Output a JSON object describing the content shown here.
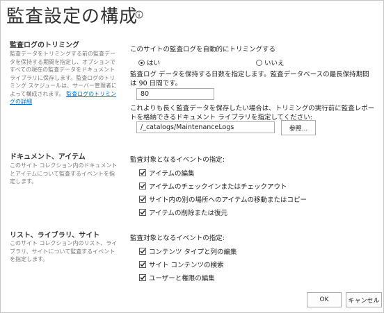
{
  "page": {
    "title": "監査設定の構成",
    "info_icon": "info-icon"
  },
  "trimming": {
    "title": "監査ログのトリミング",
    "description": "監査データをトリミングする前の監査データを保持する期間を指定し、オプションですべての現在の監査データをドキュメント ライブラリに保存します。監査ログのトリミング スケジュールは、サーバー管理者によって構成されます。",
    "link": "監査ログのトリミングの詳細",
    "auto_trim_label": "このサイトの監査ログを自動的にトリミングする",
    "radio_yes": "はい",
    "radio_no": "いいえ",
    "selected": "はい",
    "days_label": "監査ログ データを保持する日数を指定します。監査データベースの最長保持期間は 90 日間です。",
    "days_value": "80",
    "library_label": "これよりも長く監査データを保存したい場合は、トリミングの実行前に監査レポートを格納できるドキュメント ライブラリを指定してください:",
    "library_value": "/_catalogs/MaintenanceLogs",
    "browse_button": "参照..."
  },
  "documents": {
    "title": "ドキュメント、アイテム",
    "description": "このサイト コレクション内のドキュメントとアイテムについて監査するイベントを指定します。",
    "events_label": "監査対象となるイベントの指定:",
    "events": [
      {
        "label": "アイテムの編集",
        "checked": true
      },
      {
        "label": "アイテムのチェックインまたはチェックアウト",
        "checked": true
      },
      {
        "label": "サイト内の別の場所へのアイテムの移動またはコピー",
        "checked": true
      },
      {
        "label": "アイテムの削除または復元",
        "checked": true
      }
    ]
  },
  "lists": {
    "title": "リスト、ライブラリ、サイト",
    "description": "このサイト コレクション内のリスト、ライブラリ、サイトについて監査するイベントを指定します。",
    "events_label": "監査対象となるイベントの指定:",
    "events": [
      {
        "label": "コンテンツ タイプと列の編集",
        "checked": true
      },
      {
        "label": "サイト コンテンツの検索",
        "checked": true
      },
      {
        "label": "ユーザーと権限の編集",
        "checked": true
      }
    ]
  },
  "footer": {
    "ok_button": "OK",
    "cancel_button": "キャンセル"
  }
}
